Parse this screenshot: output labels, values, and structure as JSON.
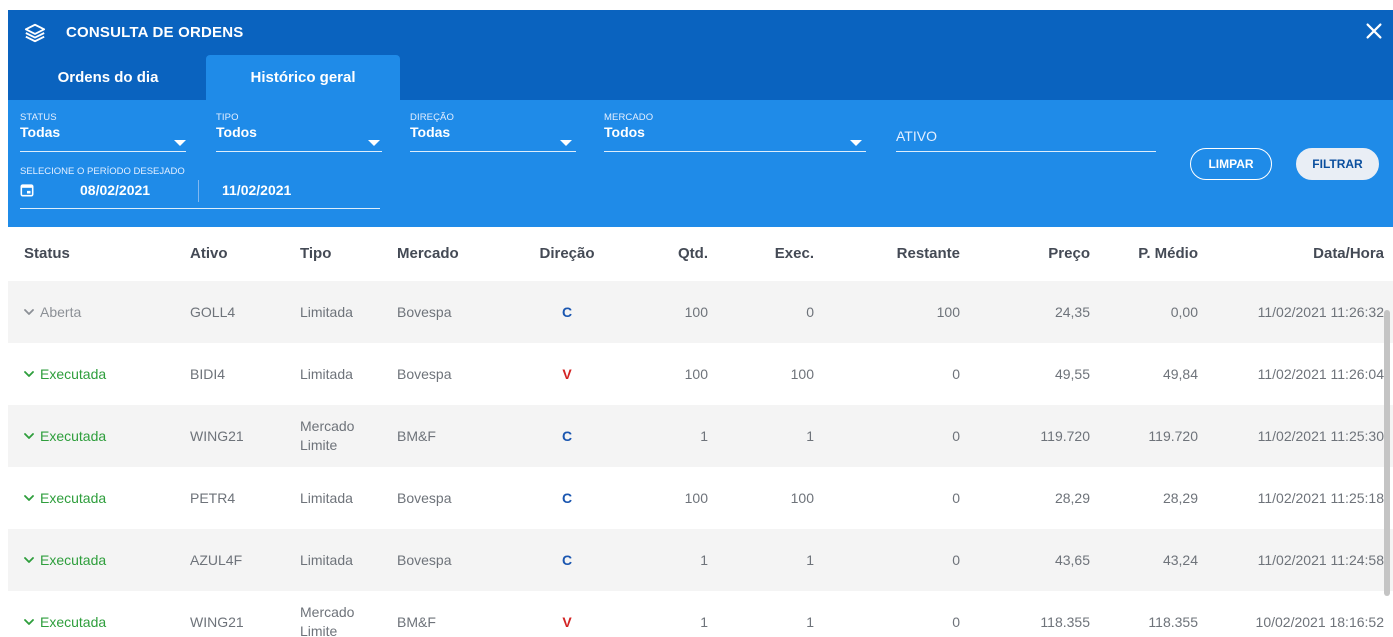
{
  "window": {
    "title": "CONSULTA DE ORDENS",
    "icon": "layers-icon",
    "close_icon": "close-icon"
  },
  "tabs": [
    {
      "label": "Ordens do dia",
      "active": false
    },
    {
      "label": "Histórico geral",
      "active": true
    }
  ],
  "filters": {
    "status": {
      "label": "STATUS",
      "value": "Todas"
    },
    "tipo": {
      "label": "TIPO",
      "value": "Todos"
    },
    "direcao": {
      "label": "DIREÇÃO",
      "value": "Todas"
    },
    "mercado": {
      "label": "MERCADO",
      "value": "Todos"
    },
    "ativo": {
      "placeholder": "ATIVO"
    },
    "period": {
      "label": "SELECIONE O PERÍODO DESEJADO",
      "start": "08/02/2021",
      "end": "11/02/2021"
    },
    "limpar_label": "LIMPAR",
    "filtrar_label": "FILTRAR"
  },
  "columns": [
    "Status",
    "Ativo",
    "Tipo",
    "Mercado",
    "Direção",
    "Qtd.",
    "Exec.",
    "Restante",
    "Preço",
    "P. Médio",
    "Data/Hora"
  ],
  "rows": [
    {
      "status": "Aberta",
      "status_type": "open",
      "ativo": "GOLL4",
      "tipo": "Limitada",
      "mercado": "Bovespa",
      "direcao": "C",
      "qtd": "100",
      "exec": "0",
      "restante": "100",
      "preco": "24,35",
      "pmedio": "0,00",
      "datahora": "11/02/2021 11:26:32"
    },
    {
      "status": "Executada",
      "status_type": "exec",
      "ativo": "BIDI4",
      "tipo": "Limitada",
      "mercado": "Bovespa",
      "direcao": "V",
      "qtd": "100",
      "exec": "100",
      "restante": "0",
      "preco": "49,55",
      "pmedio": "49,84",
      "datahora": "11/02/2021 11:26:04"
    },
    {
      "status": "Executada",
      "status_type": "exec",
      "ativo": "WING21",
      "tipo": "Mercado Limite",
      "mercado": "BM&F",
      "direcao": "C",
      "qtd": "1",
      "exec": "1",
      "restante": "0",
      "preco": "119.720",
      "pmedio": "119.720",
      "datahora": "11/02/2021 11:25:30"
    },
    {
      "status": "Executada",
      "status_type": "exec",
      "ativo": "PETR4",
      "tipo": "Limitada",
      "mercado": "Bovespa",
      "direcao": "C",
      "qtd": "100",
      "exec": "100",
      "restante": "0",
      "preco": "28,29",
      "pmedio": "28,29",
      "datahora": "11/02/2021 11:25:18"
    },
    {
      "status": "Executada",
      "status_type": "exec",
      "ativo": "AZUL4F",
      "tipo": "Limitada",
      "mercado": "Bovespa",
      "direcao": "C",
      "qtd": "1",
      "exec": "1",
      "restante": "0",
      "preco": "43,65",
      "pmedio": "43,24",
      "datahora": "11/02/2021 11:24:58"
    },
    {
      "status": "Executada",
      "status_type": "exec",
      "ativo": "WING21",
      "tipo": "Mercado Limite",
      "mercado": "BM&F",
      "direcao": "V",
      "qtd": "1",
      "exec": "1",
      "restante": "0",
      "preco": "118.355",
      "pmedio": "118.355",
      "datahora": "10/02/2021 18:16:52"
    }
  ],
  "colors": {
    "header": "#0a63bf",
    "filters": "#1f8be8",
    "executed": "#2e9e3c",
    "buy": "#1a56b0",
    "sell": "#d32424"
  }
}
